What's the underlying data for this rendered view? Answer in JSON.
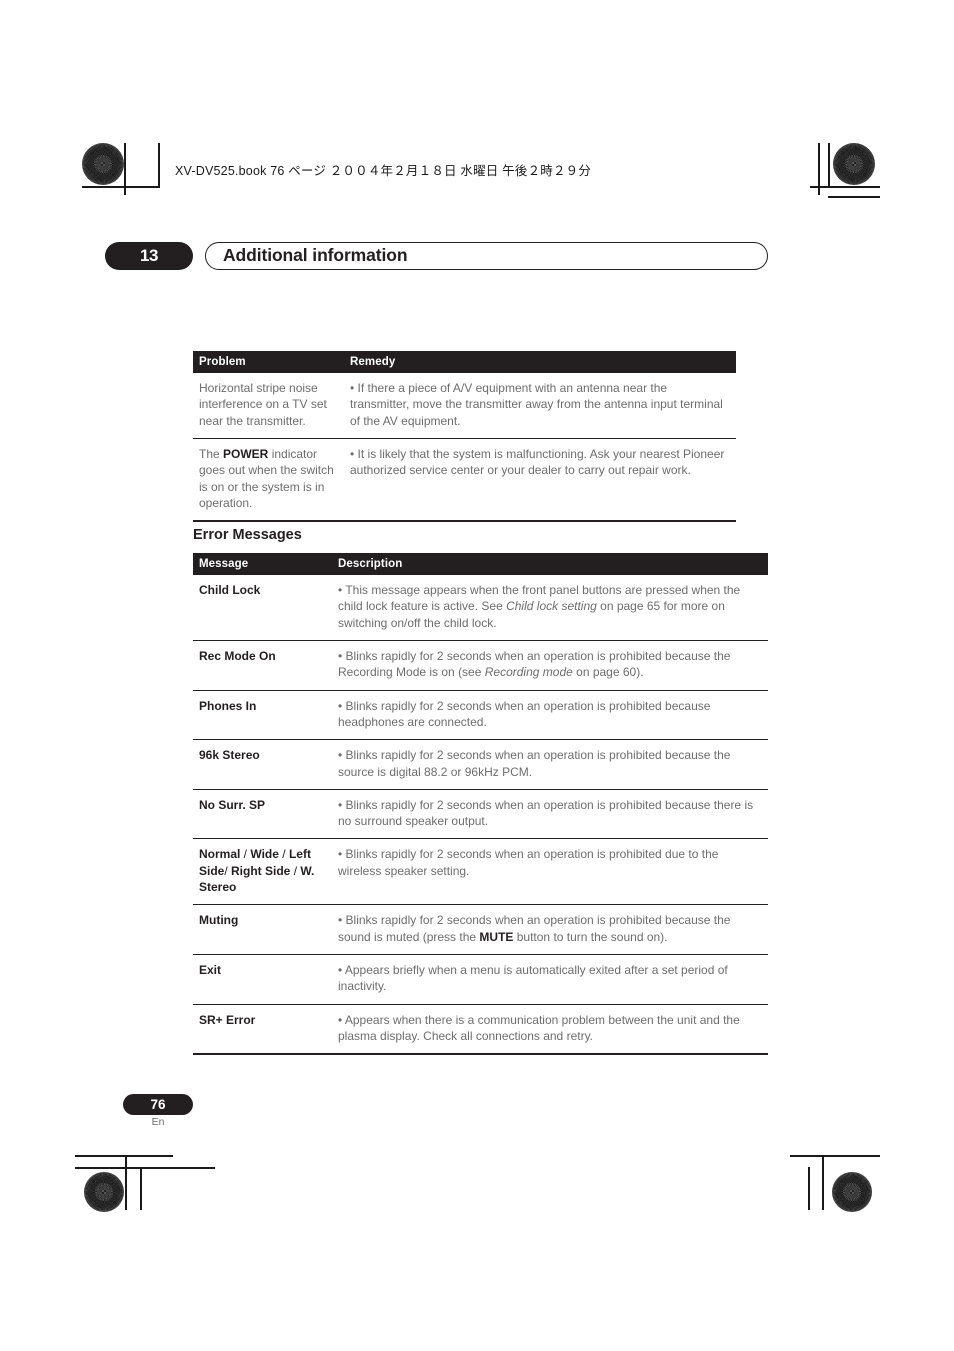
{
  "print_header": {
    "text": "XV-DV525.book  76 ページ  ２００４年２月１８日   水曜日   午後２時２９分"
  },
  "chapter": {
    "number": "13",
    "title": "Additional information"
  },
  "troubleshooting_table": {
    "headers": [
      "Problem",
      "Remedy"
    ],
    "rows": [
      {
        "problem": "Horizontal stripe noise interference on a TV set near the transmitter.",
        "remedy": "• If there a piece of A/V equipment with an antenna near the transmitter, move the transmitter away from the antenna input terminal of the AV equipment."
      },
      {
        "problem_prefix": "The ",
        "problem_bold": "POWER",
        "problem_suffix": " indicator goes out when the switch is on or the system is in operation.",
        "remedy": "• It is likely that the system is malfunctioning. Ask your nearest Pioneer authorized service center or your dealer to carry out repair work."
      }
    ]
  },
  "error_section": {
    "heading": "Error Messages",
    "headers": [
      "Message",
      "Description"
    ],
    "rows": [
      {
        "message": "Child Lock",
        "desc_part1": "• This message appears when the front panel buttons are pressed when the child lock feature is active. See ",
        "desc_italic": "Child lock setting",
        "desc_part2": " on page 65 for more on switching on/off the child lock."
      },
      {
        "message": "Rec Mode On",
        "desc_part1": "• Blinks rapidly for 2 seconds when an operation is prohibited because the Recording Mode is on (see ",
        "desc_italic": "Recording mode",
        "desc_part2": " on page 60)."
      },
      {
        "message": "Phones In",
        "desc_part1": "• Blinks rapidly for 2 seconds when an operation is prohibited because headphones are connected.",
        "desc_italic": "",
        "desc_part2": ""
      },
      {
        "message": "96k Stereo",
        "desc_part1": "• Blinks rapidly for 2 seconds when an operation is prohibited because the source is digital 88.2 or 96kHz PCM.",
        "desc_italic": "",
        "desc_part2": ""
      },
      {
        "message": "No Surr. SP",
        "desc_part1": "• Blinks rapidly for 2 seconds when an operation is prohibited because there is no surround speaker output.",
        "desc_italic": "",
        "desc_part2": ""
      },
      {
        "message_rich": true,
        "message_segments": [
          "Normal",
          " / ",
          "Wide",
          " / ",
          "Left Side",
          "/ ",
          "Right Side",
          " / ",
          "W. Stereo"
        ],
        "message": "Normal / Wide / Left Side/ Right Side / W. Stereo",
        "desc_part1": "• Blinks rapidly for 2 seconds when an operation is prohibited due to the wireless speaker setting.",
        "desc_italic": "",
        "desc_part2": ""
      },
      {
        "message": "Muting",
        "desc_part1": "• Blinks rapidly for 2 seconds when an operation is prohibited because the sound is muted (press the ",
        "desc_bold": "MUTE",
        "desc_part2": " button to turn the sound on)."
      },
      {
        "message": "Exit",
        "desc_part1": "• Appears briefly when a menu is automatically exited after a set period of inactivity.",
        "desc_italic": "",
        "desc_part2": ""
      },
      {
        "message": "SR+ Error",
        "desc_part1": "• Appears when there is a communication problem between the unit and the plasma display. Check all connections and retry.",
        "desc_italic": "",
        "desc_part2": ""
      }
    ]
  },
  "footer": {
    "page_number": "76",
    "language": "En"
  },
  "colors": {
    "ink": "#231f20",
    "body_text": "#6d6d6d",
    "paper": "#ffffff"
  }
}
